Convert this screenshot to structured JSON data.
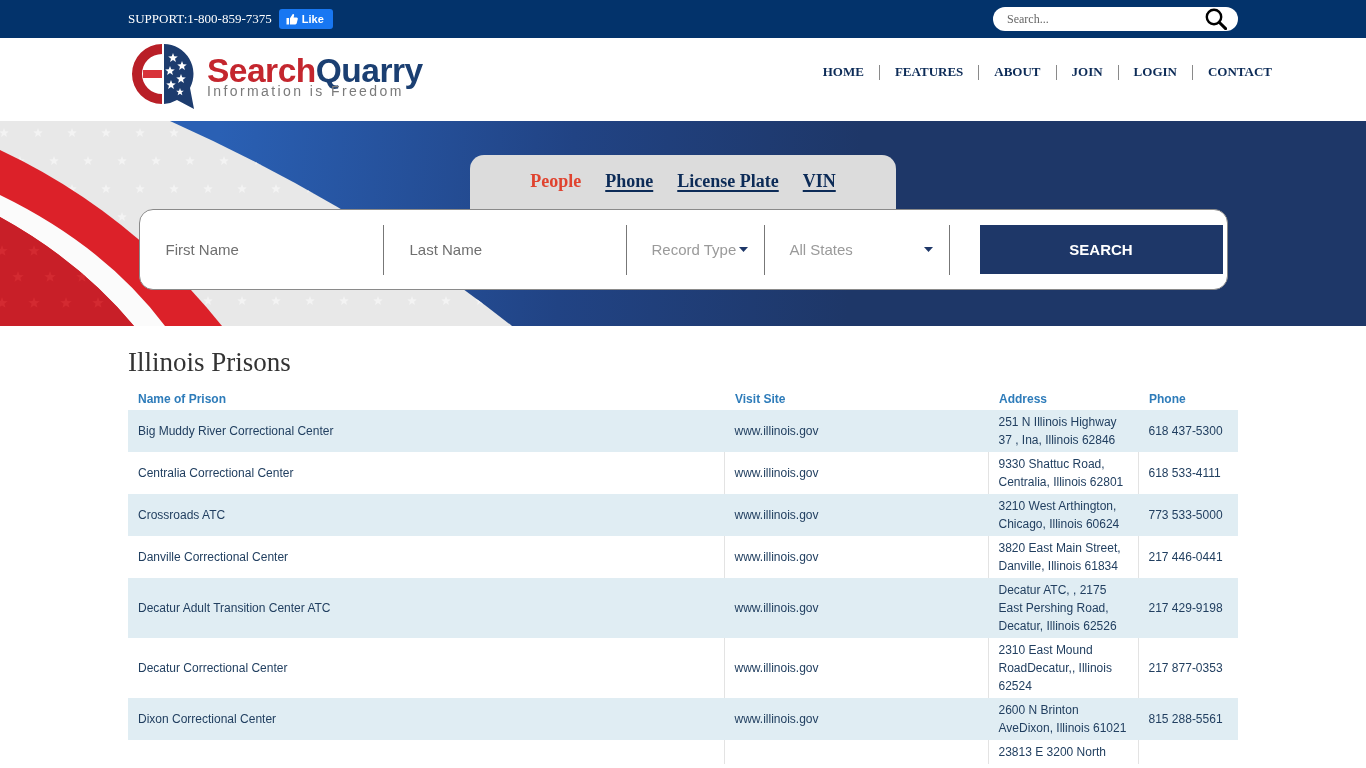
{
  "top_bar": {
    "support": "SUPPORT:1-800-859-7375",
    "like_button": "Like",
    "search": {
      "placeholder": "Search..."
    }
  },
  "header": {
    "logo": {
      "wordmark": [
        "Search",
        "Quarry"
      ],
      "tagline": "Information is Freedom"
    },
    "nav": [
      "HOME",
      "FEATURES",
      "ABOUT",
      "JOIN",
      "LOGIN",
      "CONTACT"
    ]
  },
  "hero": {
    "tabs": [
      {
        "label": "People",
        "selected": true
      },
      {
        "label": "Phone",
        "selected": false
      },
      {
        "label": "License Plate",
        "selected": false
      },
      {
        "label": "VIN",
        "selected": false
      }
    ],
    "fields": [
      {
        "kind": "text",
        "placeholder": "First Name"
      },
      {
        "kind": "text",
        "placeholder": "Last Name"
      },
      {
        "kind": "select",
        "value": "Record Type"
      },
      {
        "kind": "select",
        "value": "All States"
      }
    ],
    "search_button": "SEARCH"
  },
  "results": {
    "title": "Illinois Prisons",
    "table": {
      "columns": [
        "Name of Prison",
        "Visit Site",
        "Address",
        "Phone"
      ],
      "rows": [
        {
          "name": "Big Muddy River Correctional Center",
          "site": "www.illinois.gov",
          "address": "251 N Illinois Highway 37 , Ina, Illinois 62846",
          "phone": "618 437-5300"
        },
        {
          "name": "Centralia Correctional Center",
          "site": "www.illinois.gov",
          "address": "9330 Shattuc Road, Centralia, Illinois 62801",
          "phone": "618 533-4111"
        },
        {
          "name": "Crossroads ATC",
          "site": "www.illinois.gov",
          "address": "3210 West Arthington, Chicago, Illinois 60624",
          "phone": "773 533-5000"
        },
        {
          "name": "Danville Correctional Center",
          "site": "www.illinois.gov",
          "address": "3820 East Main Street, Danville, Illinois 61834",
          "phone": "217 446-0441"
        },
        {
          "name": "Decatur Adult Transition Center ATC",
          "site": "www.illinois.gov",
          "address": "Decatur ATC, , 2175 East Pershing Road, Decatur, Illinois 62526",
          "phone": "217 429-9198"
        },
        {
          "name": "Decatur Correctional Center",
          "site": "www.illinois.gov",
          "address": "2310 East Mound RoadDecatur,, Illinois 62524",
          "phone": "217 877-0353"
        },
        {
          "name": "Dixon Correctional Center",
          "site": "www.illinois.gov",
          "address": "2600 N Brinton AveDixon, Illinois 61021",
          "phone": "815 288-5561"
        },
        {
          "address": "23813 E 3200 North"
        }
      ]
    }
  }
}
